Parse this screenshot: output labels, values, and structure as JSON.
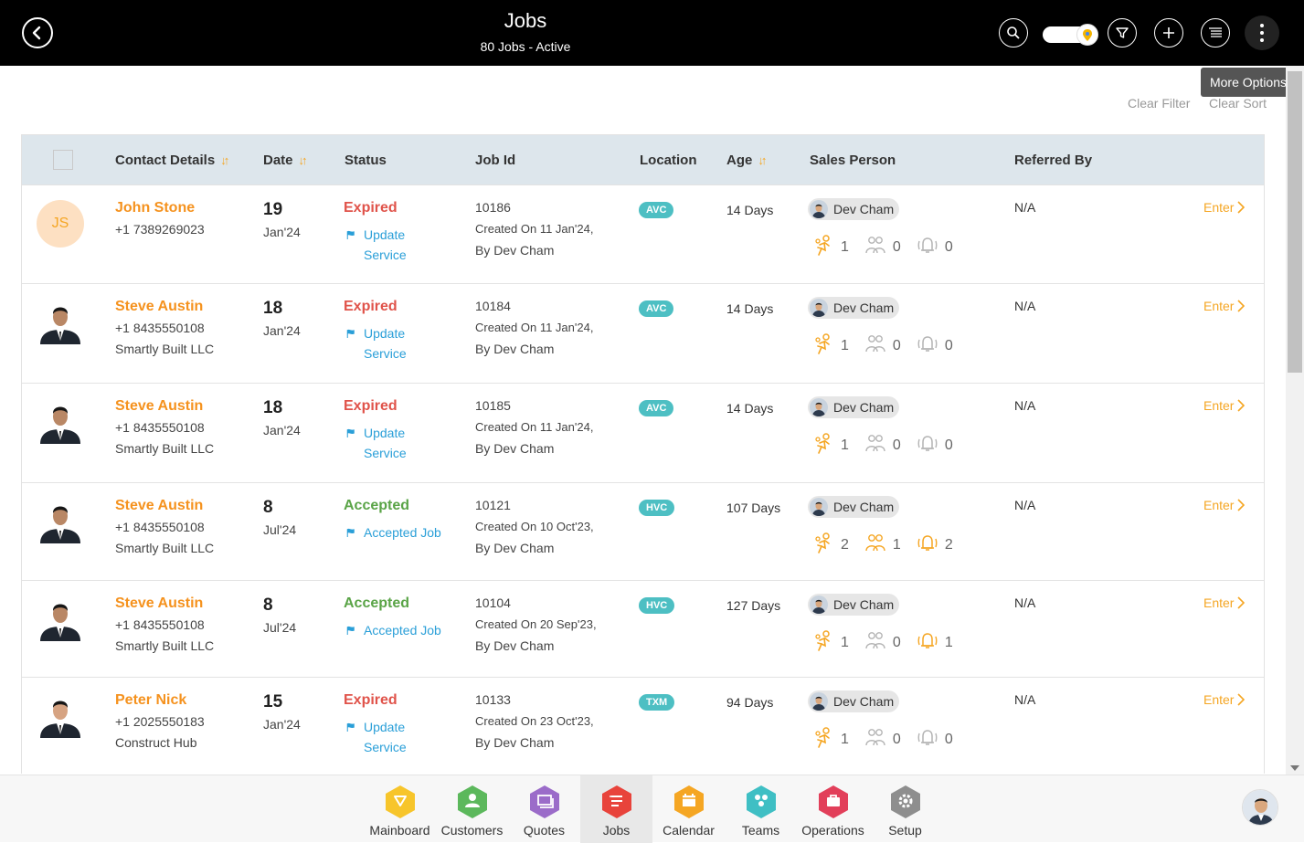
{
  "header": {
    "title": "Jobs",
    "subtitle": "80 Jobs - Active",
    "icons": [
      "back-icon",
      "search-icon",
      "map-toggle",
      "filter-icon",
      "plus-icon",
      "list-icon",
      "more-options-icon"
    ]
  },
  "tooltip": "More Options",
  "filters": {
    "clear_filter": "Clear Filter",
    "clear_sort": "Clear Sort"
  },
  "columns": {
    "contact": "Contact Details",
    "date": "Date",
    "status": "Status",
    "jobid": "Job Id",
    "location": "Location",
    "age": "Age",
    "sales": "Sales Person",
    "referred": "Referred By"
  },
  "rows": [
    {
      "avatar": "initials",
      "initials": "JS",
      "name": "John Stone",
      "phone": "+1 7389269023",
      "company": "",
      "day": "19",
      "month": "Jan'24",
      "status": "Expired",
      "status_type": "expired",
      "action": "Update Service",
      "jobid": "10186",
      "created": "Created On 11 Jan'24,",
      "by": "By Dev Cham",
      "location": "AVC",
      "age": "14 Days",
      "sales": "Dev Cham",
      "c1": "1",
      "c2": "0",
      "c3": "0",
      "referred": "N/A",
      "enter": "Enter"
    },
    {
      "avatar": "photo",
      "initials": "",
      "name": "Steve Austin",
      "phone": "+1 8435550108",
      "company": "Smartly Built LLC",
      "day": "18",
      "month": "Jan'24",
      "status": "Expired",
      "status_type": "expired",
      "action": "Update Service",
      "jobid": "10184",
      "created": "Created On 11 Jan'24,",
      "by": "By Dev Cham",
      "location": "AVC",
      "age": "14 Days",
      "sales": "Dev Cham",
      "c1": "1",
      "c2": "0",
      "c3": "0",
      "referred": "N/A",
      "enter": "Enter"
    },
    {
      "avatar": "photo",
      "initials": "",
      "name": "Steve Austin",
      "phone": "+1 8435550108",
      "company": "Smartly Built LLC",
      "day": "18",
      "month": "Jan'24",
      "status": "Expired",
      "status_type": "expired",
      "action": "Update Service",
      "jobid": "10185",
      "created": "Created On 11 Jan'24,",
      "by": "By Dev Cham",
      "location": "AVC",
      "age": "14 Days",
      "sales": "Dev Cham",
      "c1": "1",
      "c2": "0",
      "c3": "0",
      "referred": "N/A",
      "enter": "Enter"
    },
    {
      "avatar": "photo",
      "initials": "",
      "name": "Steve Austin",
      "phone": "+1 8435550108",
      "company": "Smartly Built LLC",
      "day": "8",
      "month": "Jul'24",
      "status": "Accepted",
      "status_type": "accepted",
      "action": "Accepted Job",
      "jobid": "10121",
      "created": "Created On 10 Oct'23,",
      "by": "By Dev Cham",
      "location": "HVC",
      "age": "107 Days",
      "sales": "Dev Cham",
      "c1": "2",
      "c2": "1",
      "c3": "2",
      "referred": "N/A",
      "enter": "Enter"
    },
    {
      "avatar": "photo",
      "initials": "",
      "name": "Steve Austin",
      "phone": "+1 8435550108",
      "company": "Smartly Built LLC",
      "day": "8",
      "month": "Jul'24",
      "status": "Accepted",
      "status_type": "accepted",
      "action": "Accepted Job",
      "jobid": "10104",
      "created": "Created On 20 Sep'23,",
      "by": "By Dev Cham",
      "location": "HVC",
      "age": "127 Days",
      "sales": "Dev Cham",
      "c1": "1",
      "c2": "0",
      "c3": "1",
      "referred": "N/A",
      "enter": "Enter"
    },
    {
      "avatar": "photo2",
      "initials": "",
      "name": "Peter Nick",
      "phone": "+1 2025550183",
      "company": "Construct Hub",
      "day": "15",
      "month": "Jan'24",
      "status": "Expired",
      "status_type": "expired",
      "action": "Update Service",
      "jobid": "10133",
      "created": "Created On 23 Oct'23,",
      "by": "By Dev Cham",
      "location": "TXM",
      "age": "94 Days",
      "sales": "Dev Cham",
      "c1": "1",
      "c2": "0",
      "c3": "0",
      "referred": "N/A",
      "enter": "Enter"
    }
  ],
  "nav": [
    {
      "label": "Mainboard",
      "color": "#f7c52b",
      "icon": "mainboard-icon"
    },
    {
      "label": "Customers",
      "color": "#5cb85c",
      "icon": "customers-icon"
    },
    {
      "label": "Quotes",
      "color": "#9b6cc9",
      "icon": "quotes-icon"
    },
    {
      "label": "Jobs",
      "color": "#e8433b",
      "icon": "jobs-icon",
      "active": true
    },
    {
      "label": "Calendar",
      "color": "#f5a623",
      "icon": "calendar-icon"
    },
    {
      "label": "Teams",
      "color": "#3fbfc4",
      "icon": "teams-icon"
    },
    {
      "label": "Operations",
      "color": "#e23f5a",
      "icon": "operations-icon"
    },
    {
      "label": "Setup",
      "color": "#8e8e8e",
      "icon": "setup-icon"
    }
  ],
  "colors": {
    "accent": "#f5921e",
    "expired": "#e0534a",
    "accepted": "#5aa447",
    "link": "#2a9fd8",
    "location_badge": "#4dbfc3"
  }
}
